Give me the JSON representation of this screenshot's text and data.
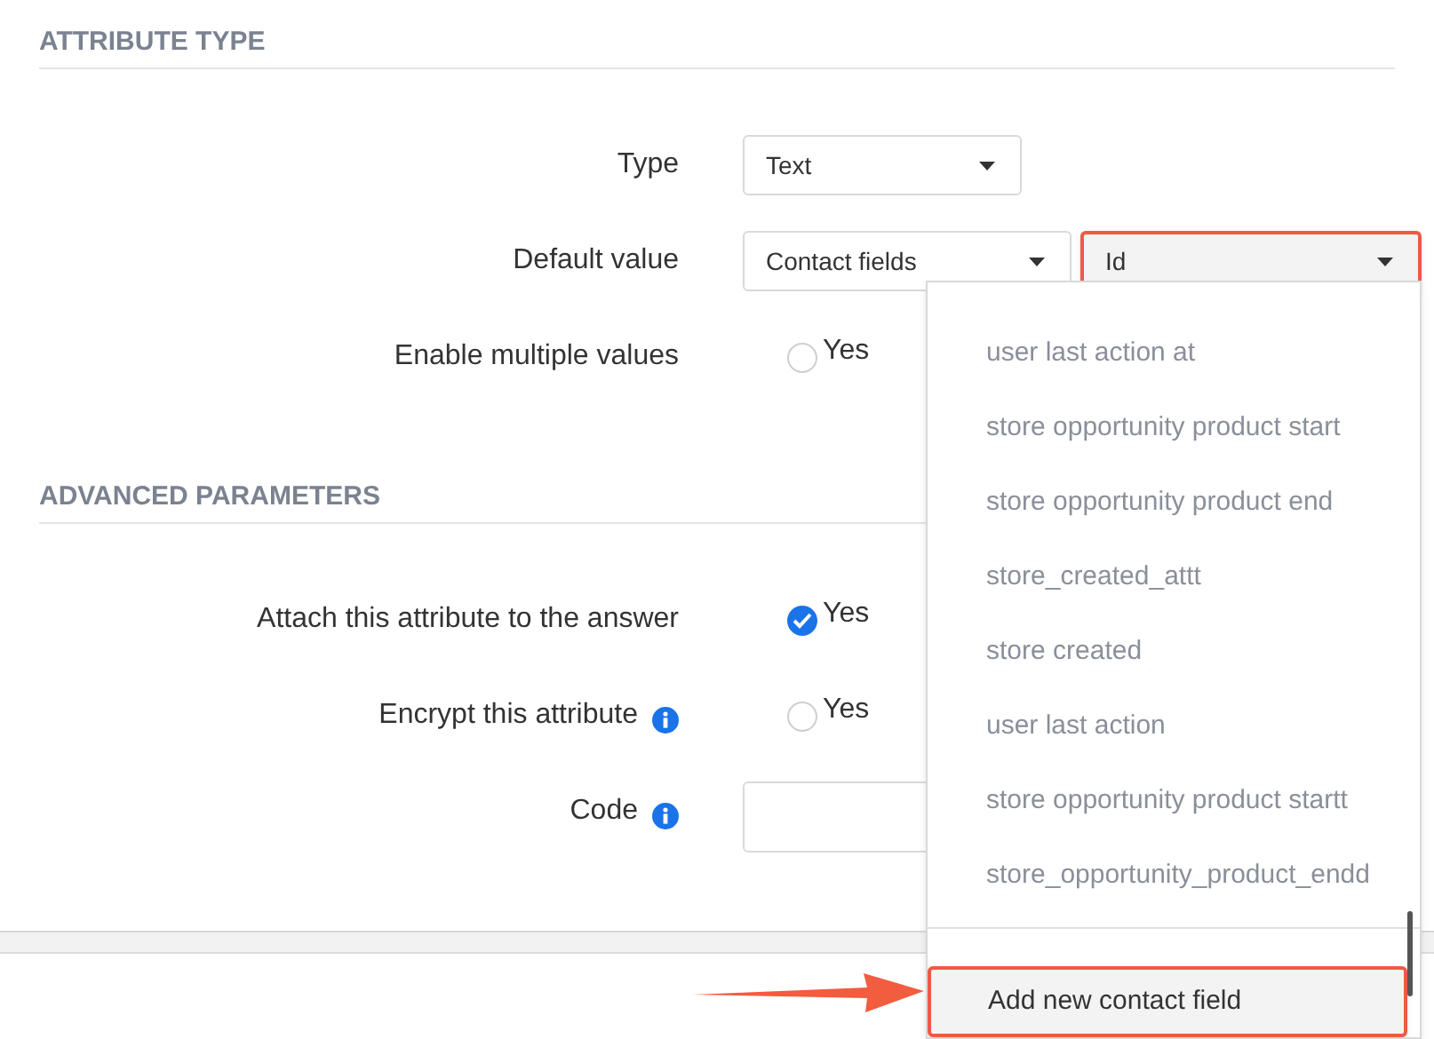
{
  "sections": [
    {
      "title": "ATTRIBUTE TYPE",
      "fields": [
        {
          "kind": "select",
          "label": "Type",
          "info": false,
          "selects": [
            {
              "value": "Text",
              "highlighted": false
            }
          ]
        },
        {
          "kind": "select",
          "label": "Default value",
          "info": false,
          "selects": [
            {
              "value": "Contact fields",
              "highlighted": false
            },
            {
              "value": "Id",
              "highlighted": true
            }
          ]
        },
        {
          "kind": "checkbox",
          "label": "Enable multiple values",
          "info": false,
          "option": "Yes",
          "checked": false
        }
      ]
    },
    {
      "title": "ADVANCED PARAMETERS",
      "fields": [
        {
          "kind": "checkbox",
          "label": "Attach this attribute to the answer",
          "info": false,
          "option": "Yes",
          "checked": true
        },
        {
          "kind": "checkbox",
          "label": "Encrypt this attribute",
          "info": true,
          "option": "Yes",
          "checked": false
        },
        {
          "kind": "input",
          "label": "Code",
          "info": true
        }
      ]
    }
  ],
  "dropdown": {
    "items": [
      "user last action at",
      "store opportunity product start",
      "store opportunity product end",
      "store_created_attt",
      "store created",
      "user last action",
      "store opportunity product startt",
      "store_opportunity_product_endd"
    ],
    "action": {
      "label": "Add new contact field",
      "highlighted": true
    }
  }
}
